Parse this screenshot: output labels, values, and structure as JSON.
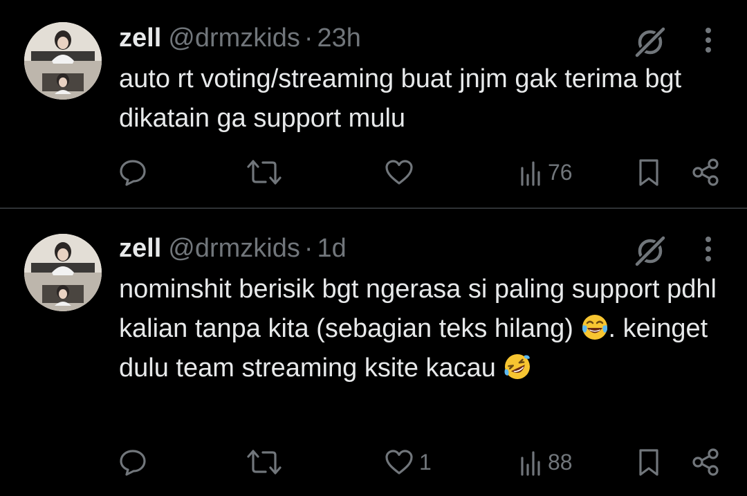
{
  "tweets": [
    {
      "author_name": "zell",
      "handle": "@drmzkids",
      "separator": "·",
      "time": "23h",
      "text_before_emoji": "auto rt voting/streaming buat jnjm gak terima bgt dikatain ga support mulu",
      "emoji_1": "",
      "text_middle": "",
      "emoji_2": "",
      "likes": "",
      "views": "76"
    },
    {
      "author_name": "zell",
      "handle": "@drmzkids",
      "separator": "·",
      "time": "1d",
      "text_before_emoji": "nominshit berisik bgt ngerasa si paling support pdhl kalian tanpa kita (sebagian teks hilang) ",
      "emoji_1": "face-with-tears-of-joy",
      "text_middle": ". keinget dulu team streaming ksite kacau ",
      "emoji_2": "rolling-on-the-floor-laughing",
      "likes": "1",
      "views": "88"
    }
  ],
  "colors": {
    "background": "#000000",
    "text_primary": "#e7e9ea",
    "text_secondary": "#71767b",
    "divider": "#2f3336"
  },
  "icons": {
    "reply": "reply-icon",
    "retweet": "retweet-icon",
    "like": "heart-icon",
    "views": "views-chart-icon",
    "bookmark": "bookmark-icon",
    "share": "share-icon",
    "grok": "grok-icon",
    "more": "more-vertical-icon"
  }
}
